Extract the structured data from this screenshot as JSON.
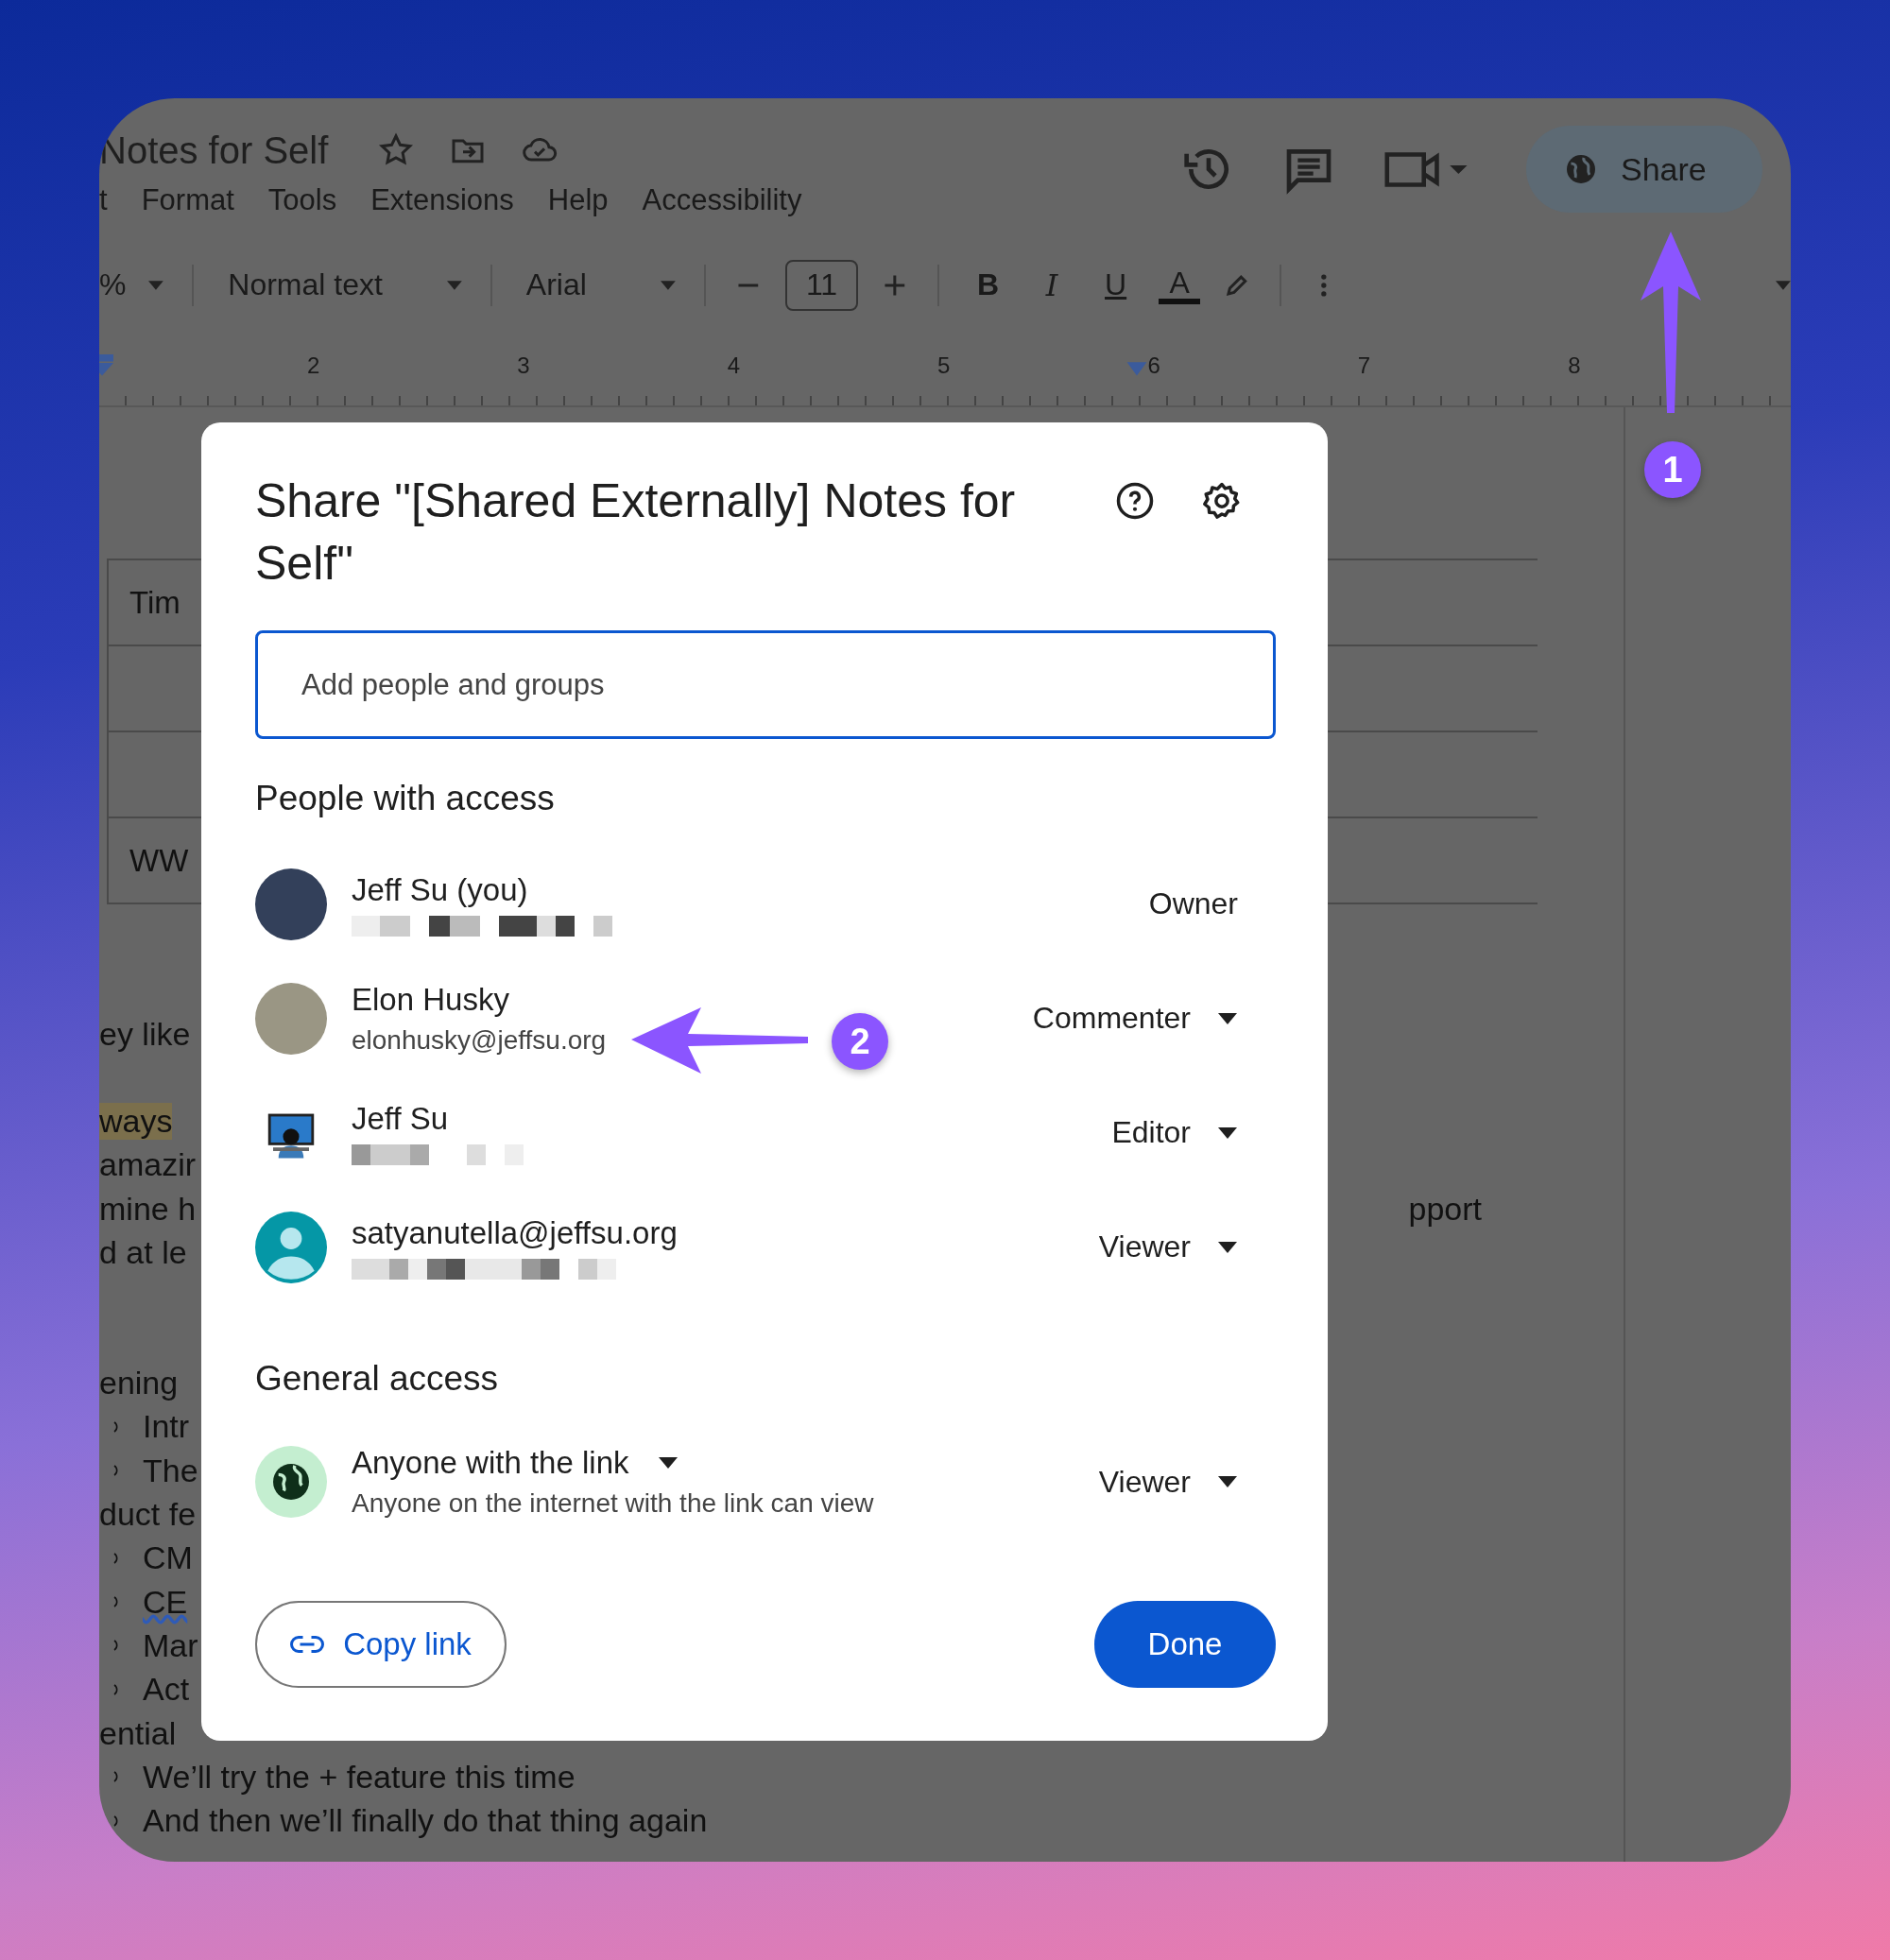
{
  "document": {
    "title": "Notes for Self",
    "menu": [
      "t",
      "Format",
      "Tools",
      "Extensions",
      "Help",
      "Accessibility"
    ],
    "share_button": "Share",
    "toolbar": {
      "zoom": "%",
      "style": "Normal text",
      "font": "Arial",
      "font_size": "11",
      "bold": "B",
      "italic": "I",
      "underline": "U",
      "text_color": "A"
    },
    "ruler": [
      "2",
      "3",
      "4",
      "5",
      "6",
      "7",
      "8"
    ],
    "table": {
      "rows": [
        {
          "cell": "Tim"
        },
        {},
        {},
        {
          "cell": "WW"
        }
      ]
    },
    "body": [
      {
        "lines": [
          {
            "text": "ey like",
            "kind": "plain"
          }
        ]
      },
      {
        "lines": [
          {
            "text": "ways",
            "kind": "highlighted"
          },
          {
            "text": "amazir",
            "kind": "plain"
          },
          {
            "text": "mine h",
            "kind": "plain",
            "tail": "pport"
          },
          {
            "text": "d at le",
            "kind": "plain"
          }
        ]
      },
      {
        "lines": [
          {
            "text": "ening",
            "kind": "plain"
          },
          {
            "text": "Intr",
            "kind": "bullet"
          },
          {
            "text": "The",
            "kind": "bullet"
          },
          {
            "text": "duct fe",
            "kind": "plain"
          },
          {
            "text": "CM",
            "kind": "bullet"
          },
          {
            "text": "CE",
            "kind": "bullet_flagged"
          },
          {
            "text": "Mar",
            "kind": "bullet"
          },
          {
            "text": "Act",
            "kind": "bullet"
          },
          {
            "text": "ential",
            "kind": "plain"
          },
          {
            "text": "We’ll try the + feature this time",
            "kind": "bullet"
          },
          {
            "text": "And then we’ll finally do that thing again",
            "kind": "bullet"
          }
        ]
      }
    ]
  },
  "share_dialog": {
    "title": "Share \"[Shared Externally] Notes for Self\"",
    "search": {
      "placeholder": "Add people and groups"
    },
    "people_heading": "People with access",
    "people": [
      {
        "name": "Jeff Su (you)",
        "kind": "photo",
        "email_redacted": true,
        "role": "Owner",
        "role_menu": false
      },
      {
        "name": "Elon Husky",
        "kind": "photo",
        "email": "elonhusky@jeffsu.org",
        "email_redacted": false,
        "role": "Commenter",
        "role_menu": true
      },
      {
        "name": "Jeff Su",
        "kind": "illustration",
        "email_redacted": true,
        "role": "Editor",
        "role_menu": true
      },
      {
        "name": "satyanutella@jeffsu.org",
        "kind": "default",
        "email_redacted": true,
        "role": "Viewer",
        "role_menu": true
      }
    ],
    "general_access_heading": "General access",
    "general_access": {
      "scope": "Anyone with the link",
      "description": "Anyone on the internet with the link can view",
      "role": "Viewer"
    },
    "copy_link_button": "Copy link",
    "done_button": "Done"
  },
  "annotations": [
    {
      "label": "1"
    },
    {
      "label": "2"
    }
  ]
}
